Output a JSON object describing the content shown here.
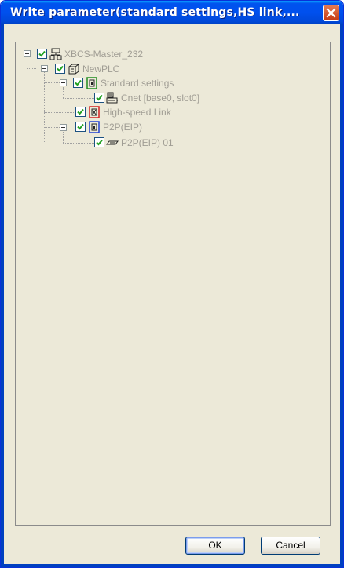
{
  "window": {
    "title": "Write parameter(standard settings,HS link,..."
  },
  "tree": {
    "nodes": [
      {
        "label": "XBCS-Master_232",
        "icon": "network-station-icon",
        "checked": true,
        "expander": "collapse"
      },
      {
        "label": "NewPLC",
        "icon": "plc-icon",
        "checked": true,
        "expander": "collapse"
      },
      {
        "label": "Standard settings",
        "icon": "standard-settings-icon",
        "checked": true,
        "expander": "collapse"
      },
      {
        "label": "Cnet [base0, slot0]",
        "icon": "cnet-module-icon",
        "checked": true
      },
      {
        "label": "High-speed Link",
        "icon": "highspeed-link-icon",
        "checked": true
      },
      {
        "label": "P2P(EIP)",
        "icon": "p2p-icon",
        "checked": true,
        "expander": "collapse"
      },
      {
        "label": "P2P(EIP) 01",
        "icon": "p2p-block-icon",
        "checked": true
      }
    ]
  },
  "buttons": {
    "ok": "OK",
    "cancel": "Cancel"
  },
  "colors": {
    "title_bar": "#0053EE",
    "dialog_bg": "#ECE9D8",
    "check_mark": "#21A121",
    "label_text": "#A09D94"
  }
}
